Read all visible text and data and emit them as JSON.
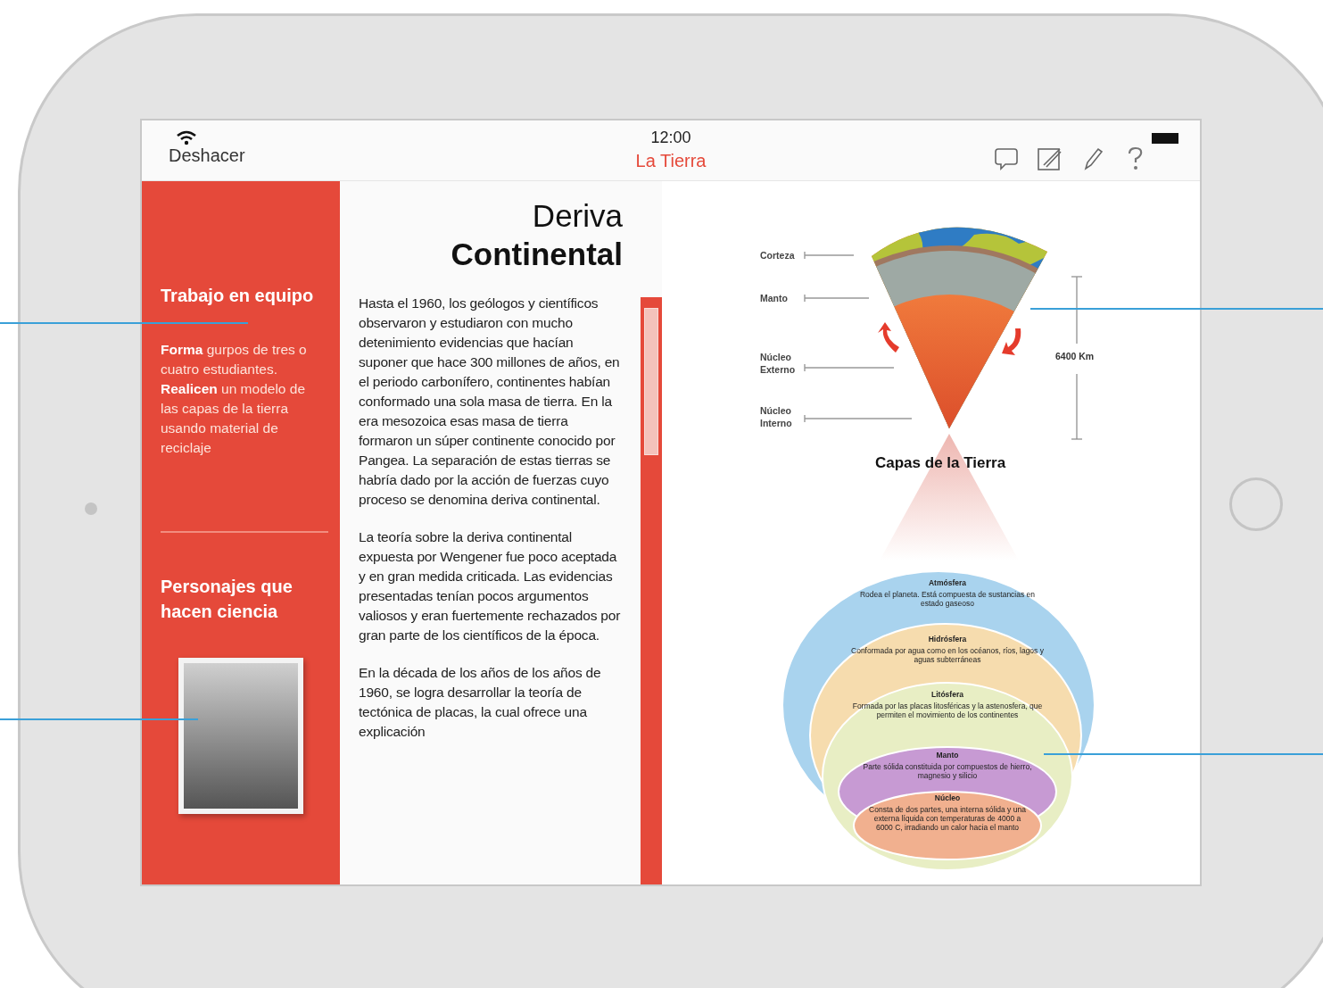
{
  "status_bar": {
    "time": "12:00"
  },
  "nav_bar": {
    "back_button": "Deshacer",
    "title": "La Tierra"
  },
  "sidebar": {
    "sections": [
      {
        "heading": "Trabajo en equipo",
        "text": "**Forma** gurpos de tres o cuatro estudiantes. **Realicen** un modelo de las capas de la tierra usando material de reciclaje"
      },
      {
        "heading": "Personajes que hacen ciencia"
      }
    ]
  },
  "article": {
    "title_light": "Deriva",
    "title_bold": "Continental",
    "paragraphs": [
      "Hasta el 1960, los geólogos y científicos observaron y estudiaron con mucho detenimiento evidencias que hacían suponer que hace 300 millones de años, en el periodo carbonífero, continentes habían conformado una sola masa de tierra. En la era mesozoica esas masa de tierra formaron un súper continente conocido por Pangea. La separación de estas tierras se habría dado por la acción de fuerzas cuyo proceso se denomina deriva continental.",
      "La teoría sobre la deriva continental expuesta por Wengener fue poco aceptada y en gran medida criticada. Las evidencias presentadas tenían pocos argumentos valiosos y eran fuertemente rechazados por gran parte de los científicos de la época.",
      "En la década de los años de los años de 1960, se logra desarrollar la teoría de tectónica de placas, la cual ofrece una explicación"
    ]
  },
  "earth_diagram": {
    "labels": [
      "Corteza",
      "Manto",
      "Núcleo Externo",
      "Núcleo Interno"
    ],
    "scale": "6400 Km",
    "caption": "Capas de la Tierra"
  },
  "spheres": [
    {
      "name": "Atmósfera",
      "description": "Rodea el planeta. Está compuesta de sustancias en estado gaseoso",
      "color": "#a9d3ee"
    },
    {
      "name": "Hidrósfera",
      "description": "Conformada por agua como en los océanos, ríos, lagos y aguas subterráneas",
      "color": "#f6dcae"
    },
    {
      "name": "Litósfera",
      "description": "Formada por las placas litosféricas y la astenosfera, que permiten el movimiento de los continentes",
      "color": "#e8eec4"
    },
    {
      "name": "Manto",
      "description": "Parte sólida constituida por compuestos de hierro, magnesio y silicio",
      "color": "#c79ad3"
    },
    {
      "name": "Núcleo",
      "description": "Consta de dos partes, una interna sólida y una externa líquida con temperaturas de 4000 a 6000 C, irradiando un calor hacia el manto",
      "color": "#f1b08f"
    }
  ]
}
